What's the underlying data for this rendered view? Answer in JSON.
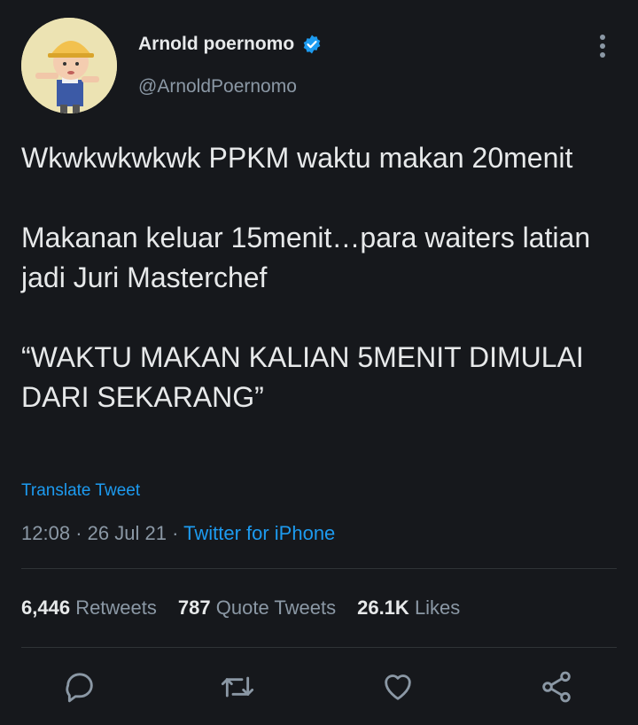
{
  "author": {
    "name": "Arnold poernomo",
    "handle": "@ArnoldPoernomo",
    "verified": true
  },
  "tweet": {
    "paragraphs": [
      "Wkwkwkwkwk PPKM waktu makan 20menit",
      "Makanan keluar 15menit…para waiters latian jadi Juri Masterchef",
      "“WAKTU MAKAN KALIAN 5MENIT DIMULAI DARI SEKARANG”"
    ],
    "translate_label": "Translate Tweet",
    "time": "12:08",
    "date": "26 Jul 21",
    "separator": "·",
    "source": "Twitter for iPhone"
  },
  "stats": {
    "retweets_count": "6,446",
    "retweets_label": "Retweets",
    "quotes_count": "787",
    "quotes_label": "Quote Tweets",
    "likes_count": "26.1K",
    "likes_label": "Likes"
  },
  "icons": {
    "reply": "reply-icon",
    "retweet": "retweet-icon",
    "like": "heart-icon",
    "share": "share-icon",
    "more": "more-vertical-icon",
    "verified": "verified-badge-icon"
  },
  "colors": {
    "background": "#16181c",
    "text": "#e7e9ea",
    "secondary": "#8b98a5",
    "accent": "#1d9bf0"
  }
}
